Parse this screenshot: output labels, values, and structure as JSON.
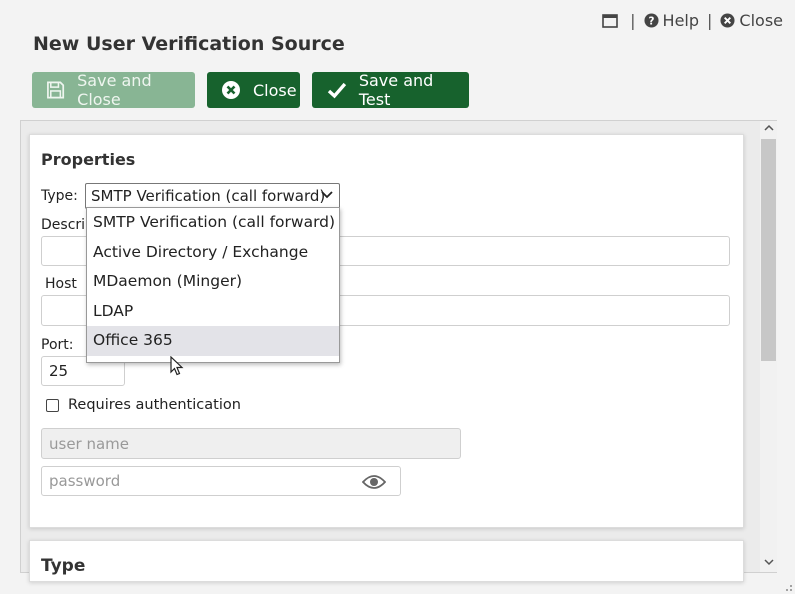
{
  "header": {
    "title": "New User Verification Source",
    "links": {
      "separator": "|",
      "help": "Help",
      "close": "Close"
    }
  },
  "toolbar": {
    "save_close_label": "Save and Close",
    "close_label": "Close",
    "save_test_label": "Save and Test"
  },
  "properties": {
    "heading": "Properties",
    "type_label": "Type:",
    "type_selected": "SMTP Verification (call forward)",
    "type_options": [
      "SMTP Verification (call forward)",
      "Active Directory / Exchange",
      "MDaemon (Minger)",
      "LDAP",
      "Office 365"
    ],
    "hovered_option": "Office 365",
    "description_label": "Descri",
    "description_value": "",
    "host_label": "Host",
    "host_value": "",
    "port_label": "Port:",
    "port_value": "25",
    "requires_auth_label": "Requires authentication",
    "requires_auth_checked": false,
    "username_placeholder": "user name",
    "password_placeholder": "password"
  },
  "type_section": {
    "heading": "Type"
  },
  "colors": {
    "primary_green": "#17622d",
    "disabled_green": "#88b594",
    "background": "#f3f3f3"
  }
}
